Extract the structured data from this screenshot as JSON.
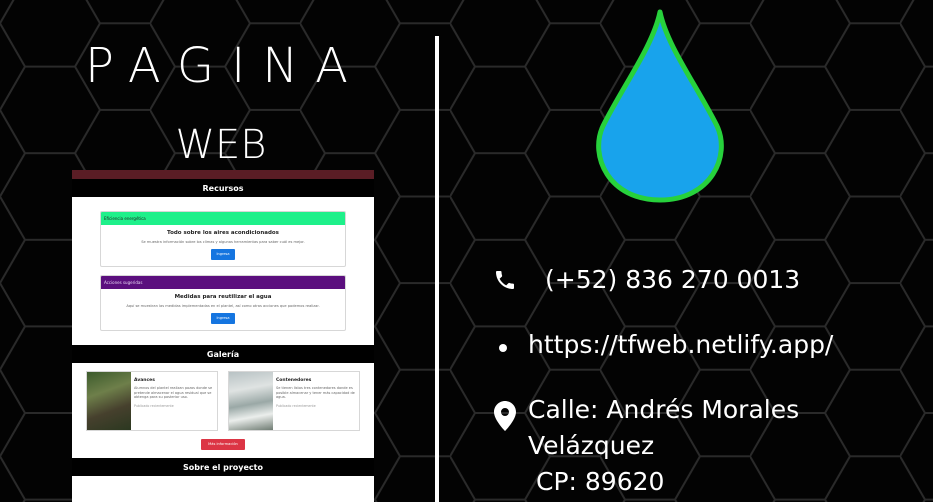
{
  "left": {
    "title": "PAGINA",
    "subtitle": "WEB"
  },
  "preview": {
    "section_recursos": "Recursos",
    "cards": [
      {
        "tag": "Eficiencia energética",
        "title": "Todo sobre los aires acondicionados",
        "text": "Se muestra información sobre los climas y algunas herramientas para saber cuál es mejor.",
        "button": "Ingresa"
      },
      {
        "tag": "Acciones sugeridas",
        "title": "Medidas para reutilizar el agua",
        "text": "Aquí se muestran las medidas implementadas en el plantel, así como otras acciones que podemos realizar.",
        "button": "Ingresa"
      }
    ],
    "section_galeria": "Galería",
    "gallery": [
      {
        "title": "Avances",
        "text": "Alumnos del plantel realizan pozos donde se pretende almacenar el agua residual que se obtenga para su posterior uso.",
        "date": "Publicado recientemente"
      },
      {
        "title": "Contenedores",
        "text": "Se tienen listos tres contenedores donde es posible almacenar y tener más capacidad de agua.",
        "date": "Publicado recientemente"
      }
    ],
    "more_button": "Más información",
    "section_sobre": "Sobre el proyecto"
  },
  "contact": {
    "phone": "(+52) 836 270 0013",
    "url": "https://tfweb.netlify.app/",
    "address_line1": "Calle: Andrés Morales",
    "address_line2": "Velázquez",
    "address_line3": "CP: 89620"
  },
  "icons": {
    "phone": "phone-icon",
    "bullet": "bullet-icon",
    "location": "location-pin-icon",
    "drop": "water-drop-icon"
  },
  "colors": {
    "background": "#030303",
    "drop_fill": "#18a3ec",
    "drop_outline": "#27d13c",
    "recursos_bar": "#5a1d25",
    "tag_green": "#1ef08a",
    "tag_purple": "#5b0f7e",
    "button_blue": "#1575e0",
    "button_red": "#dc3545"
  }
}
